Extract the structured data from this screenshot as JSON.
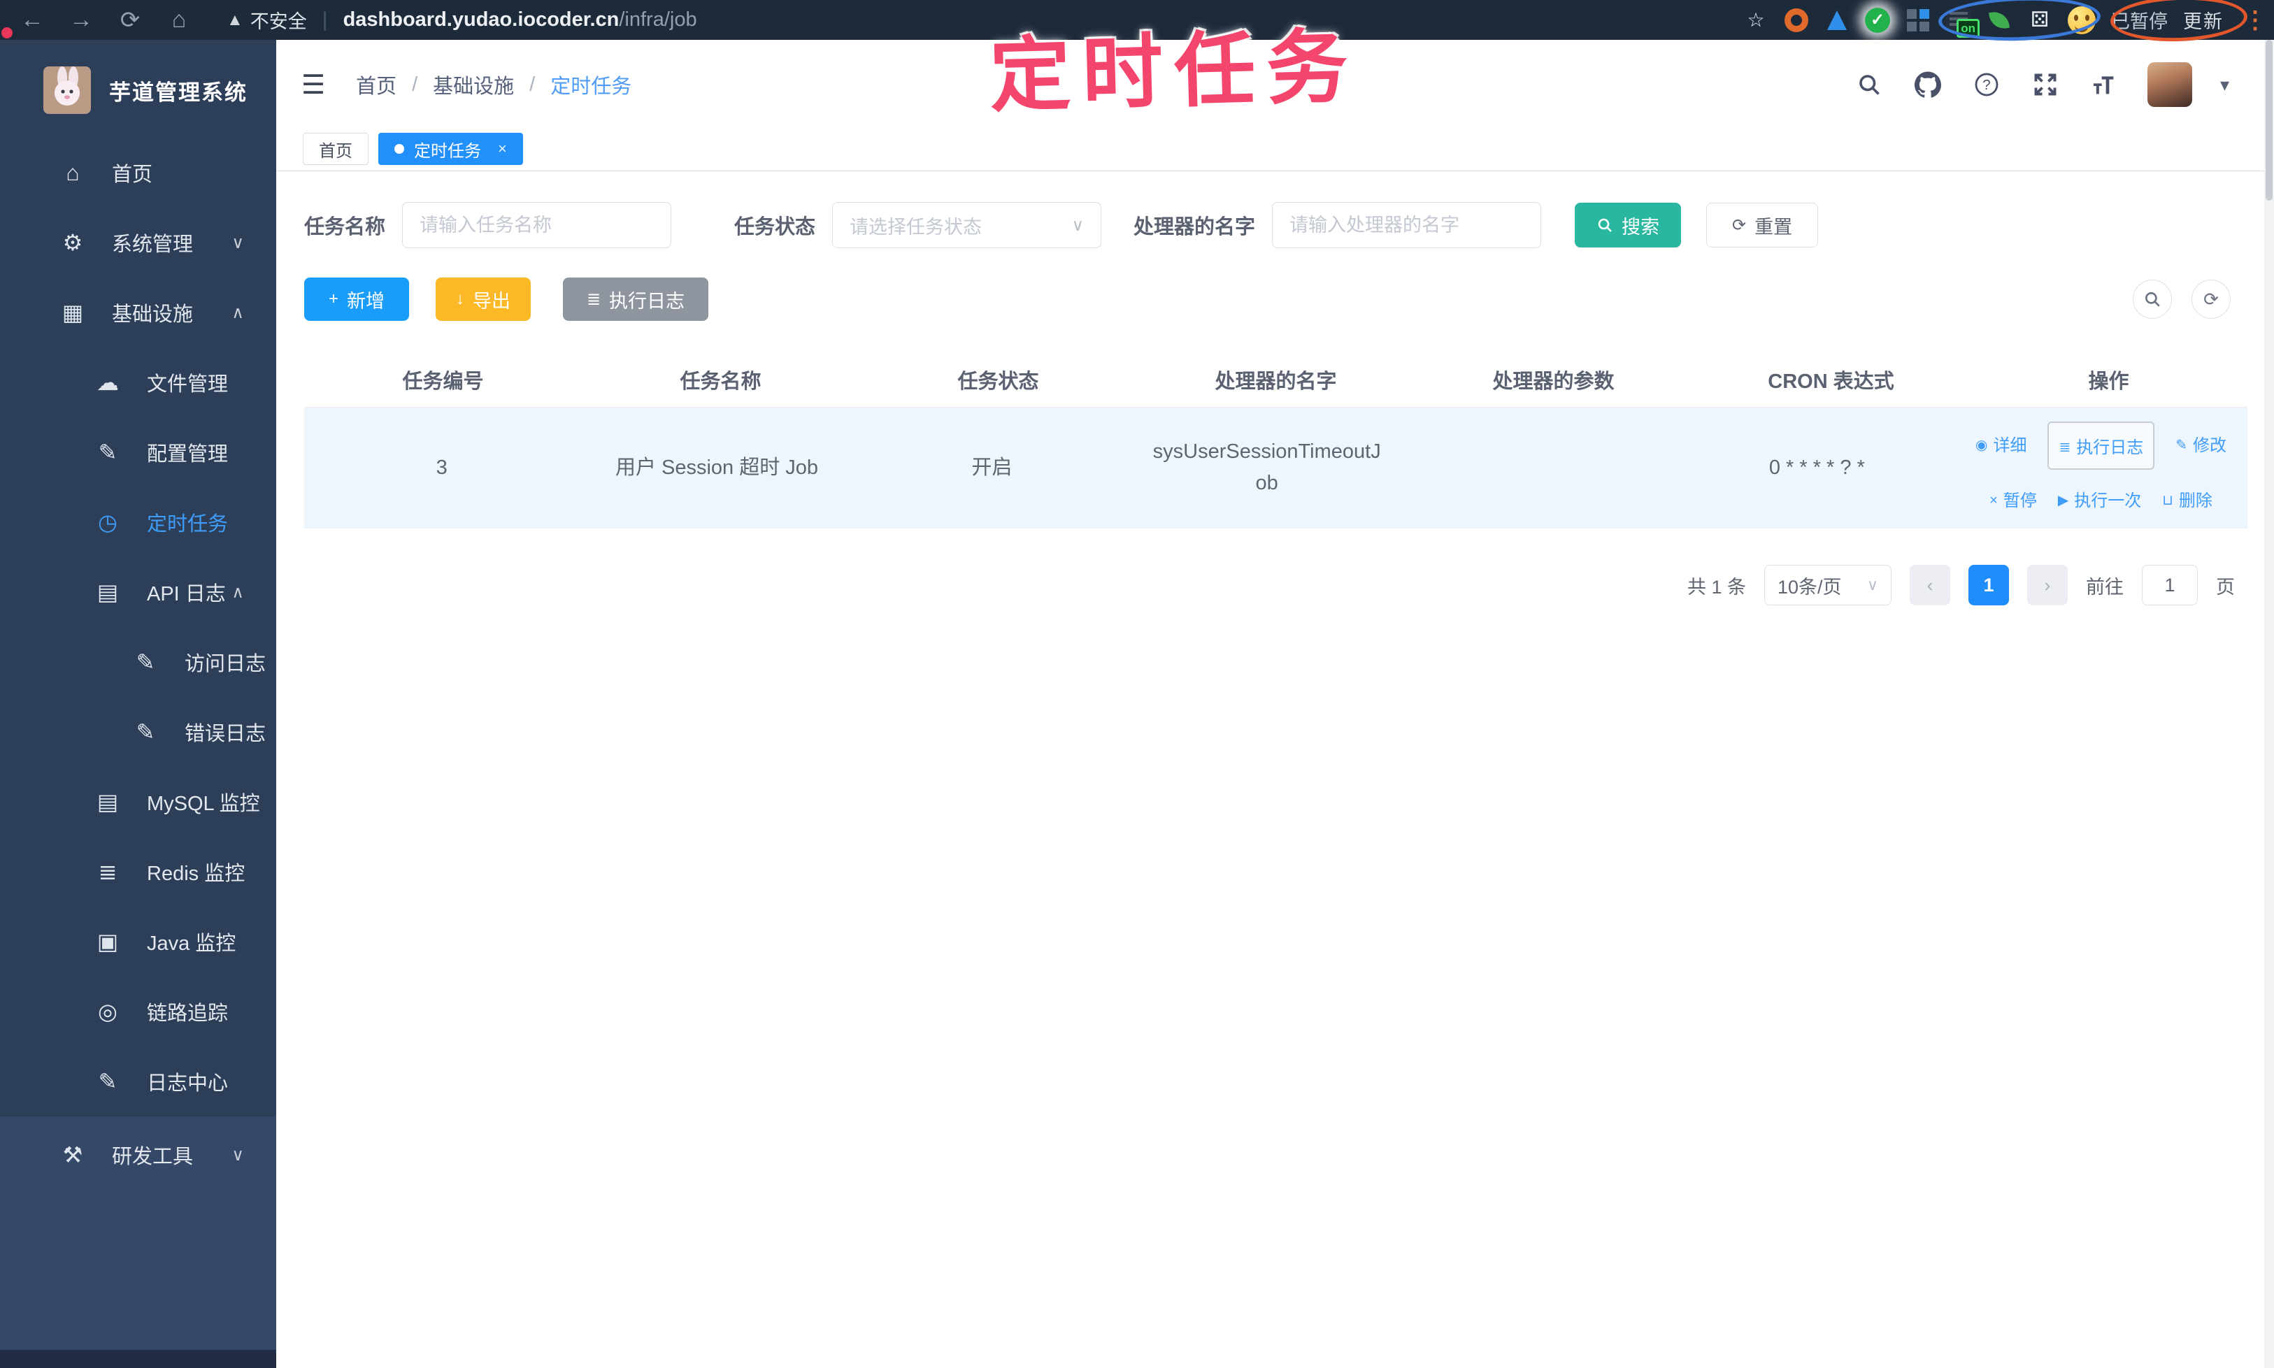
{
  "browser": {
    "security_label": "不安全",
    "url_host": "dashboard.yudao.iocoder.cn",
    "url_path": "/infra/job",
    "on_badge": "on",
    "paused_badge": "已暂停",
    "update_button": "更新"
  },
  "annotation": {
    "text": "定时任务",
    "color": "#f4466d"
  },
  "sidebar": {
    "app_title": "芋道管理系统",
    "items": [
      {
        "label": "首页"
      },
      {
        "label": "系统管理"
      },
      {
        "label": "基础设施"
      },
      {
        "label": "文件管理"
      },
      {
        "label": "配置管理"
      },
      {
        "label": "定时任务"
      },
      {
        "label": "API 日志"
      },
      {
        "label": "访问日志"
      },
      {
        "label": "错误日志"
      },
      {
        "label": "MySQL 监控"
      },
      {
        "label": "Redis 监控"
      },
      {
        "label": "Java 监控"
      },
      {
        "label": "链路追踪"
      },
      {
        "label": "日志中心"
      },
      {
        "label": "研发工具"
      }
    ]
  },
  "header": {
    "breadcrumb": [
      "首页",
      "基础设施",
      "定时任务"
    ],
    "tabs": [
      {
        "label": "首页"
      },
      {
        "label": "定时任务"
      }
    ]
  },
  "filters": {
    "name_label": "任务名称",
    "name_placeholder": "请输入任务名称",
    "status_label": "任务状态",
    "status_placeholder": "请选择任务状态",
    "handler_label": "处理器的名字",
    "handler_placeholder": "请输入处理器的名字",
    "search_label": "搜索",
    "reset_label": "重置"
  },
  "toolbar": {
    "add_label": "新增",
    "export_label": "导出",
    "log_label": "执行日志"
  },
  "table": {
    "headers": [
      "任务编号",
      "任务名称",
      "任务状态",
      "处理器的名字",
      "处理器的参数",
      "CRON 表达式",
      "操作"
    ],
    "rows": [
      {
        "id": "3",
        "name": "用户 Session 超时 Job",
        "status": "开启",
        "handler": "sysUserSessionTimeoutJob",
        "param": "",
        "cron": "0 * * * * ? *",
        "actions": {
          "detail": "详细",
          "log": "执行日志",
          "edit": "修改",
          "pause": "暂停",
          "run_once": "执行一次",
          "delete": "删除"
        }
      }
    ]
  },
  "pagination": {
    "total_label": "共 1 条",
    "page_size": "10条/页",
    "current_page": "1",
    "goto_label": "前往",
    "goto_value": "1",
    "page_unit": "页"
  },
  "icons": {
    "back": "←",
    "forward": "→",
    "reload": "⟳",
    "home_nav": "⌂",
    "warning": "▲",
    "star": "☆",
    "puzzle": "⚄",
    "dots": "⋮",
    "collapse": "☰",
    "caret_down": "▾",
    "home": "⌂",
    "gear": "⚙",
    "infra": "▦",
    "cloud": "☁",
    "edit": "✎",
    "timer": "◷",
    "api_log": "▤",
    "doc": "✎",
    "mysql": "▤",
    "redis": "≣",
    "java": "▣",
    "trace": "◎",
    "log_center": "✎",
    "tools": "⚒",
    "chevron_down": "∨",
    "chevron_up": "∧",
    "plus": "+",
    "download": "↓",
    "list": "≣",
    "refresh": "⟳",
    "act_detail": "◉",
    "act_log": "≣",
    "act_edit": "✎",
    "act_pause": "×",
    "act_run": "▶",
    "act_delete": "⊔",
    "sel_caret": "∨",
    "prev": "‹",
    "next": "›"
  },
  "colors": {
    "accent_blue": "#1f8efa",
    "link_blue": "#3f9dfa",
    "sidebar_bg": "#2d3e58",
    "teal": "#2ab7a0",
    "amber": "#fdb826",
    "gray_btn": "#8f959e",
    "annotation_pink": "#f4466d",
    "row_highlight": "#eef6fd",
    "browser_bar": "#1d2a3a"
  }
}
